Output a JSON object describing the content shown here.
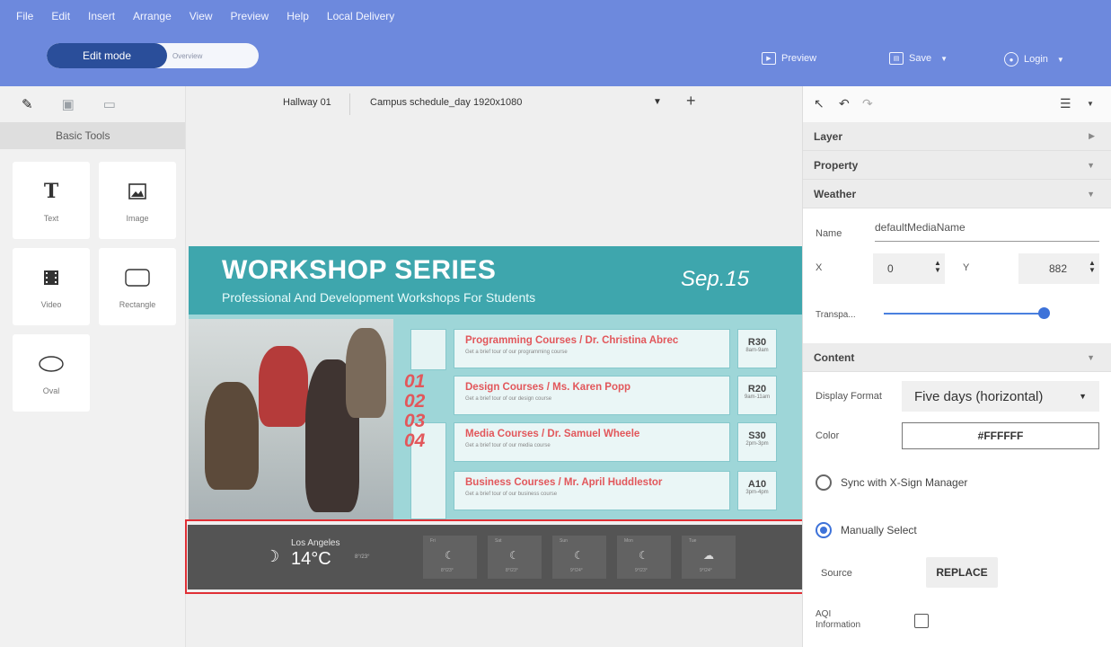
{
  "menu": [
    "File",
    "Edit",
    "Insert",
    "Arrange",
    "View",
    "Preview",
    "Help",
    "Local Delivery"
  ],
  "mode": {
    "edit_label": "Edit mode",
    "overview_label": "Overview"
  },
  "header_actions": {
    "preview": "Preview",
    "save": "Save",
    "login": "Login"
  },
  "left_panel": {
    "section_label": "Basic Tools",
    "tools": [
      {
        "label": "Text",
        "icon": "text-icon"
      },
      {
        "label": "Image",
        "icon": "image-icon"
      },
      {
        "label": "Video",
        "icon": "video-icon"
      },
      {
        "label": "Rectangle",
        "icon": "rectangle-icon"
      },
      {
        "label": "Oval",
        "icon": "oval-icon"
      }
    ]
  },
  "canvas": {
    "tab_location": "Hallway 01",
    "tab_file": "Campus schedule_day 1920x1080"
  },
  "poster": {
    "title": "WORKSHOP SERIES",
    "subtitle": "Professional And Development Workshops For Students",
    "date": "Sep.15",
    "numbers": [
      "01",
      "02",
      "03",
      "04"
    ],
    "courses": [
      {
        "title": "Programming Courses / Dr. Christina Abrec",
        "desc": "Get a brief tour of our programming course",
        "room": "R30",
        "time": "8am-9am"
      },
      {
        "title": "Design Courses / Ms. Karen Popp",
        "desc": "Get a brief tour of our design course",
        "room": "R20",
        "time": "9am-11am"
      },
      {
        "title": "Media Courses / Dr. Samuel Wheele",
        "desc": "Get a brief tour of our media course",
        "room": "S30",
        "time": "2pm-3pm"
      },
      {
        "title": "Business Courses / Mr. April Huddlestor",
        "desc": "Get a brief tour of our business course",
        "room": "A10",
        "time": "3pm-4pm"
      }
    ],
    "weather": {
      "city": "Los Angeles",
      "temp": "14°C",
      "range": "8°/23°",
      "days": [
        {
          "day": "Fri",
          "range": "8°/23°"
        },
        {
          "day": "Sat",
          "range": "8°/23°"
        },
        {
          "day": "Sun",
          "range": "9°/24°"
        },
        {
          "day": "Mon",
          "range": "9°/23°"
        },
        {
          "day": "Tue",
          "range": "9°/24°"
        }
      ]
    }
  },
  "right_panel": {
    "sections": {
      "layer": "Layer",
      "property": "Property",
      "weather": "Weather",
      "content": "Content"
    },
    "name_label": "Name",
    "name_value": "defaultMediaName",
    "x_label": "X",
    "x_value": "0",
    "y_label": "Y",
    "y_value": "882",
    "transparency_label": "Transpa...",
    "transparency_level": 1.0,
    "display_format_label": "Display Format",
    "display_format_value": "Five days (horizontal)",
    "color_label": "Color",
    "color_value": "#FFFFFF",
    "sync_label": "Sync with X-Sign Manager",
    "manual_label": "Manually Select",
    "source_label": "Source",
    "replace_label": "REPLACE",
    "aqi_label_1": "AQI",
    "aqi_label_2": "Information"
  },
  "colors": {
    "header": "#6d89dd",
    "accent": "#3d72d9",
    "poster_teal": "#3ea6ad",
    "course_red": "#e2575b",
    "highlight_red": "#e02f35"
  }
}
